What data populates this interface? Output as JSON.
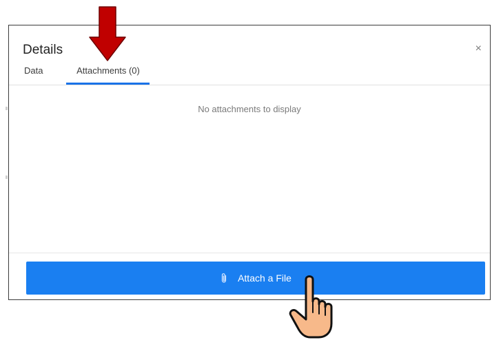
{
  "dialog": {
    "title": "Details",
    "close_label": "×"
  },
  "tabs": [
    {
      "label": "Data",
      "active": false
    },
    {
      "label": "Attachments (0)",
      "active": true
    }
  ],
  "attachments": {
    "empty_message": "No attachments to display"
  },
  "footer": {
    "attach_label": "Attach a File",
    "attach_icon": "paperclip-icon"
  },
  "annotations": {
    "arrow_icon": "down-arrow-icon",
    "arrow_color": "#c00000",
    "hand_icon": "pointing-hand-icon",
    "hand_color": "#f7b98a"
  },
  "colors": {
    "accent": "#1a7ff1",
    "tab_underline": "#1a73e8"
  }
}
